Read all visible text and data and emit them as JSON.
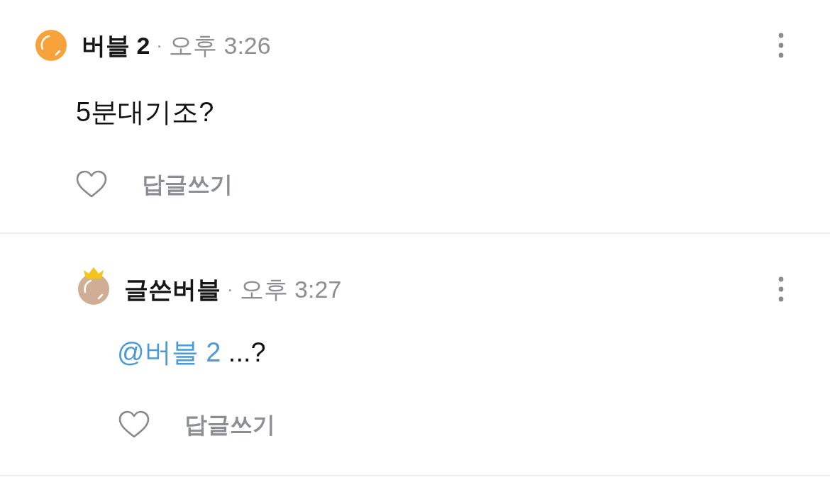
{
  "comments": [
    {
      "author": "버블 2",
      "separator": "·",
      "time": "오후 3:26",
      "avatar": {
        "color": "#f7a23b",
        "crown": false
      },
      "body": {
        "text": "5분대기조?"
      },
      "liked": false,
      "reply_label": "답글쓰기",
      "replies": [
        {
          "author": "글쓴버블",
          "separator": "·",
          "time": "오후 3:27",
          "avatar": {
            "color": "#cfae95",
            "crown": true
          },
          "body": {
            "mention": "@버블 2",
            "text": "...?"
          },
          "liked": false,
          "reply_label": "답글쓰기"
        }
      ]
    }
  ]
}
